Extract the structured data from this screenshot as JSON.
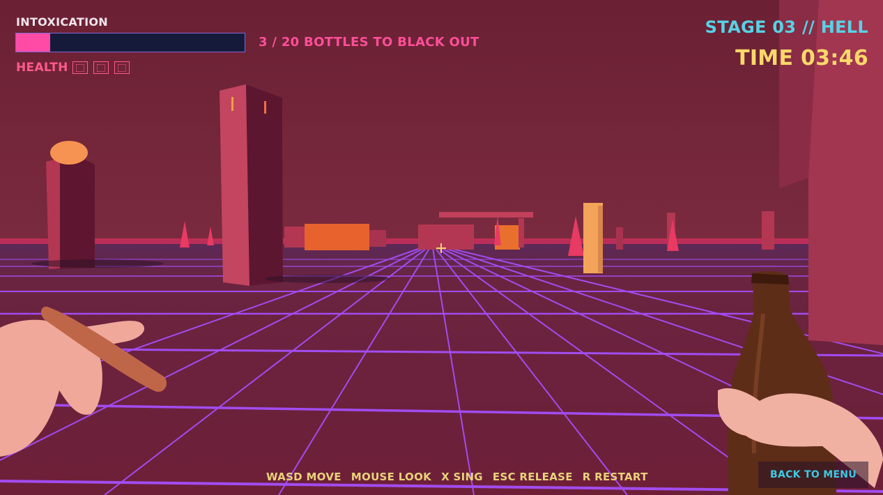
{
  "hud": {
    "intox_label": "INTOXICATION",
    "intox_fraction": 0.15,
    "bottles_text": "3 / 20 BOTTLES TO BLACK OUT",
    "health_label": "HEALTH",
    "health_icons": [
      "health-icon",
      "health-icon",
      "health-icon"
    ],
    "stage_text": "STAGE 03 // HELL",
    "time_text": "TIME 03:46"
  },
  "controls": [
    "WASD MOVE",
    "MOUSE LOOK",
    "X SING",
    "ESC RELEASE",
    "R RESTART"
  ],
  "menu": {
    "back_label": "BACK TO MENU"
  },
  "colors": {
    "sky": "#6e2236",
    "floor": "#6a1f38",
    "grid": "#a24cf0",
    "intox_fill": "#ff4aa6",
    "stage": "#56d3e6",
    "time": "#fad86a"
  }
}
